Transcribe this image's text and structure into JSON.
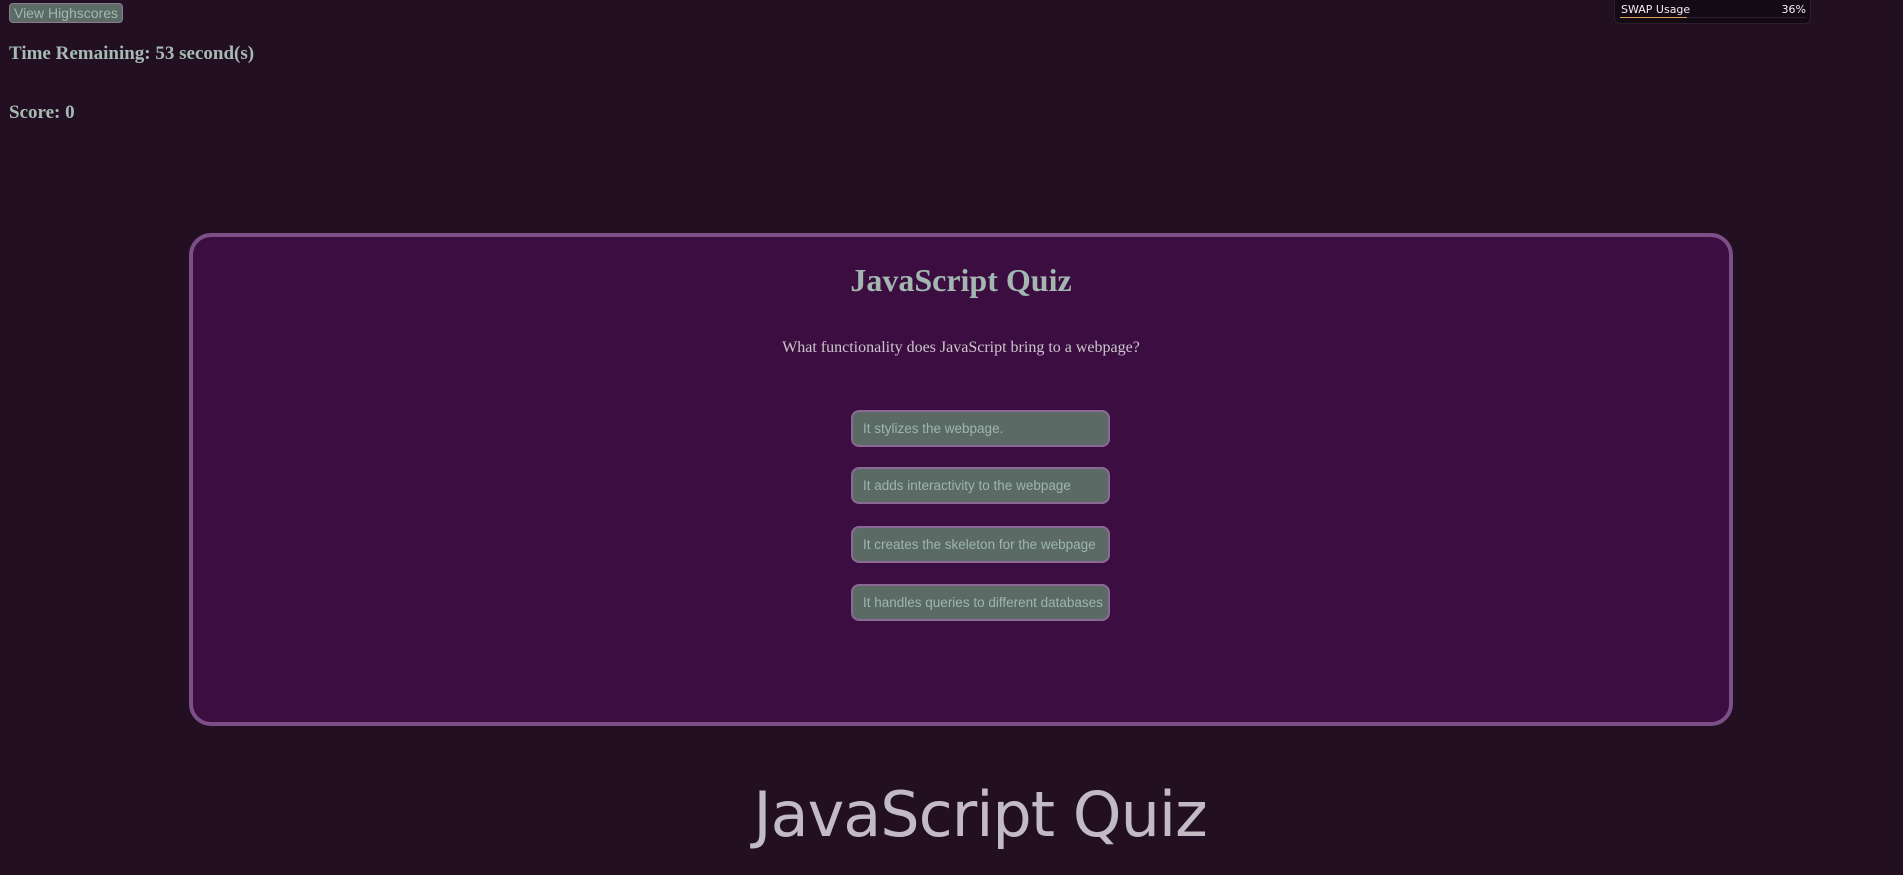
{
  "header": {
    "highscores_label": "View Highscores",
    "time_remaining": "Time Remaining: 53 second(s)",
    "score": "Score: 0"
  },
  "swap_widget": {
    "label": "SWAP Usage",
    "value": "36%",
    "fraction": 0.36
  },
  "quiz": {
    "title": "JavaScript Quiz",
    "question": "What functionality does JavaScript bring to a webpage?",
    "answers": [
      "It stylizes the webpage.",
      "It adds interactivity to the webpage",
      "It creates the skeleton for the webpage",
      "It handles queries to different databases"
    ]
  },
  "footer": {
    "title": "JavaScript Quiz"
  }
}
